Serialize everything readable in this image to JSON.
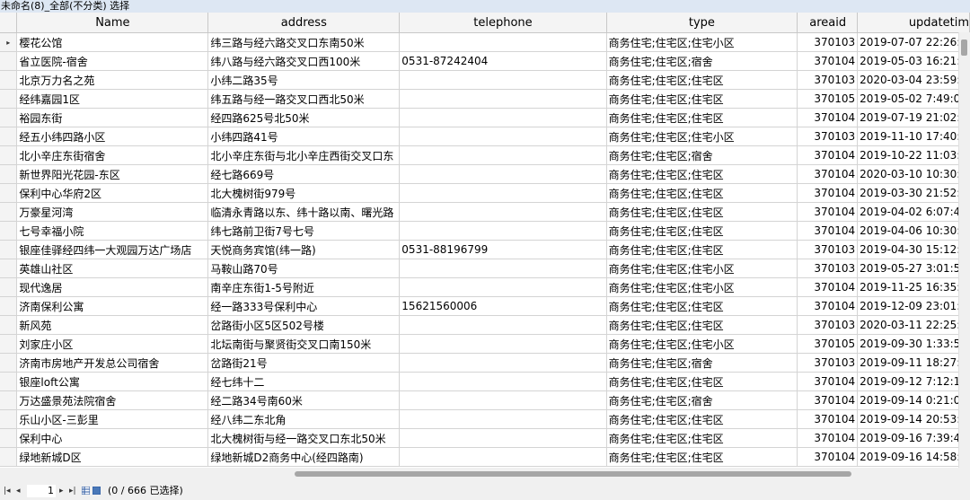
{
  "window": {
    "title": "未命名(8)_全部(不分类) 选择"
  },
  "table": {
    "columns": [
      "Name",
      "address",
      "telephone",
      "type",
      "areaid",
      "updatetim"
    ],
    "row_marker": "▸",
    "rows": [
      [
        "樱花公馆",
        "纬三路与经六路交叉口东南50米",
        "",
        "商务住宅;住宅区;住宅小区",
        "370103",
        "2019-07-07 22:26:1"
      ],
      [
        "省立医院-宿舍",
        "纬八路与经六路交叉口西100米",
        "0531-87242404",
        "商务住宅;住宅区;宿舍",
        "370104",
        "2019-05-03 16:21:0"
      ],
      [
        "北京万力名之苑",
        "小纬二路35号",
        "",
        "商务住宅;住宅区;住宅区",
        "370103",
        "2020-03-04 23:59:1"
      ],
      [
        "经纬嘉园1区",
        "纬五路与经一路交叉口西北50米",
        "",
        "商务住宅;住宅区;住宅区",
        "370105",
        "2019-05-02 7:49:00"
      ],
      [
        "裕园东街",
        "经四路625号北50米",
        "",
        "商务住宅;住宅区;住宅区",
        "370104",
        "2019-07-19 21:02:3"
      ],
      [
        "经五小纬四路小区",
        "小纬四路41号",
        "",
        "商务住宅;住宅区;住宅小区",
        "370103",
        "2019-11-10 17:40:2"
      ],
      [
        "北小辛庄东街宿舍",
        "北小辛庄东街与北小辛庄西街交叉口东",
        "",
        "商务住宅;住宅区;宿舍",
        "370104",
        "2019-10-22 11:03:4"
      ],
      [
        "新世界阳光花园-东区",
        "经七路669号",
        "",
        "商务住宅;住宅区;住宅区",
        "370104",
        "2020-03-10 10:30:3"
      ],
      [
        "保利中心华府2区",
        "北大槐树街979号",
        "",
        "商务住宅;住宅区;住宅区",
        "370104",
        "2019-03-30 21:52:4"
      ],
      [
        "万豪星河湾",
        "临清永青路以东、纬十路以南、曙光路",
        "",
        "商务住宅;住宅区;住宅区",
        "370104",
        "2019-04-02 6:07:45"
      ],
      [
        "七号幸福小院",
        "纬七路前卫街7号七号",
        "",
        "商务住宅;住宅区;住宅区",
        "370104",
        "2019-04-06 10:30:2"
      ],
      [
        "银座佳驿经四纬一大观园万达广场店",
        "天悦商务宾馆(纬一路)",
        "0531-88196799",
        "商务住宅;住宅区;住宅区",
        "370103",
        "2019-04-30 15:12:4"
      ],
      [
        "英雄山社区",
        "马鞍山路70号",
        "",
        "商务住宅;住宅区;住宅小区",
        "370103",
        "2019-05-27 3:01:50"
      ],
      [
        "现代逸居",
        "南辛庄东街1-5号附近",
        "",
        "商务住宅;住宅区;住宅小区",
        "370104",
        "2019-11-25 16:35:1"
      ],
      [
        "济南保利公寓",
        "经一路333号保利中心",
        "15621560006",
        "商务住宅;住宅区;住宅区",
        "370104",
        "2019-12-09 23:01:4"
      ],
      [
        "新风苑",
        "岔路街小区5区502号楼",
        "",
        "商务住宅;住宅区;住宅区",
        "370103",
        "2020-03-11 22:25:4"
      ],
      [
        "刘家庄小区",
        "北坛南街与聚贤街交叉口南150米",
        "",
        "商务住宅;住宅区;住宅小区",
        "370105",
        "2019-09-30 1:33:56"
      ],
      [
        "济南市房地产开发总公司宿舍",
        "岔路街21号",
        "",
        "商务住宅;住宅区;宿舍",
        "370103",
        "2019-09-11 18:27:1"
      ],
      [
        "银座loft公寓",
        "经七纬十二",
        "",
        "商务住宅;住宅区;住宅区",
        "370104",
        "2019-09-12 7:12:10"
      ],
      [
        "万达盛景苑法院宿舍",
        "经二路34号南60米",
        "",
        "商务住宅;住宅区;宿舍",
        "370104",
        "2019-09-14 0:21:05"
      ],
      [
        "乐山小区-三彭里",
        "经八纬二东北角",
        "",
        "商务住宅;住宅区;住宅区",
        "370104",
        "2019-09-14 20:53:2"
      ],
      [
        "保利中心",
        "北大槐树街与经一路交叉口东北50米",
        "",
        "商务住宅;住宅区;住宅区",
        "370104",
        "2019-09-16 7:39:43"
      ],
      [
        "绿地新城D区",
        "绿地新城D2商务中心(经四路南)",
        "",
        "商务住宅;住宅区;住宅区",
        "370104",
        "2019-09-16 14:58:4"
      ]
    ]
  },
  "statusbar": {
    "first_icon": "first-page-icon",
    "prev_icon": "prev-page-icon",
    "next_icon": "next-page-icon",
    "last_icon": "last-page-icon",
    "page": "1",
    "selection_text": "(0 / 666 已选择)"
  }
}
